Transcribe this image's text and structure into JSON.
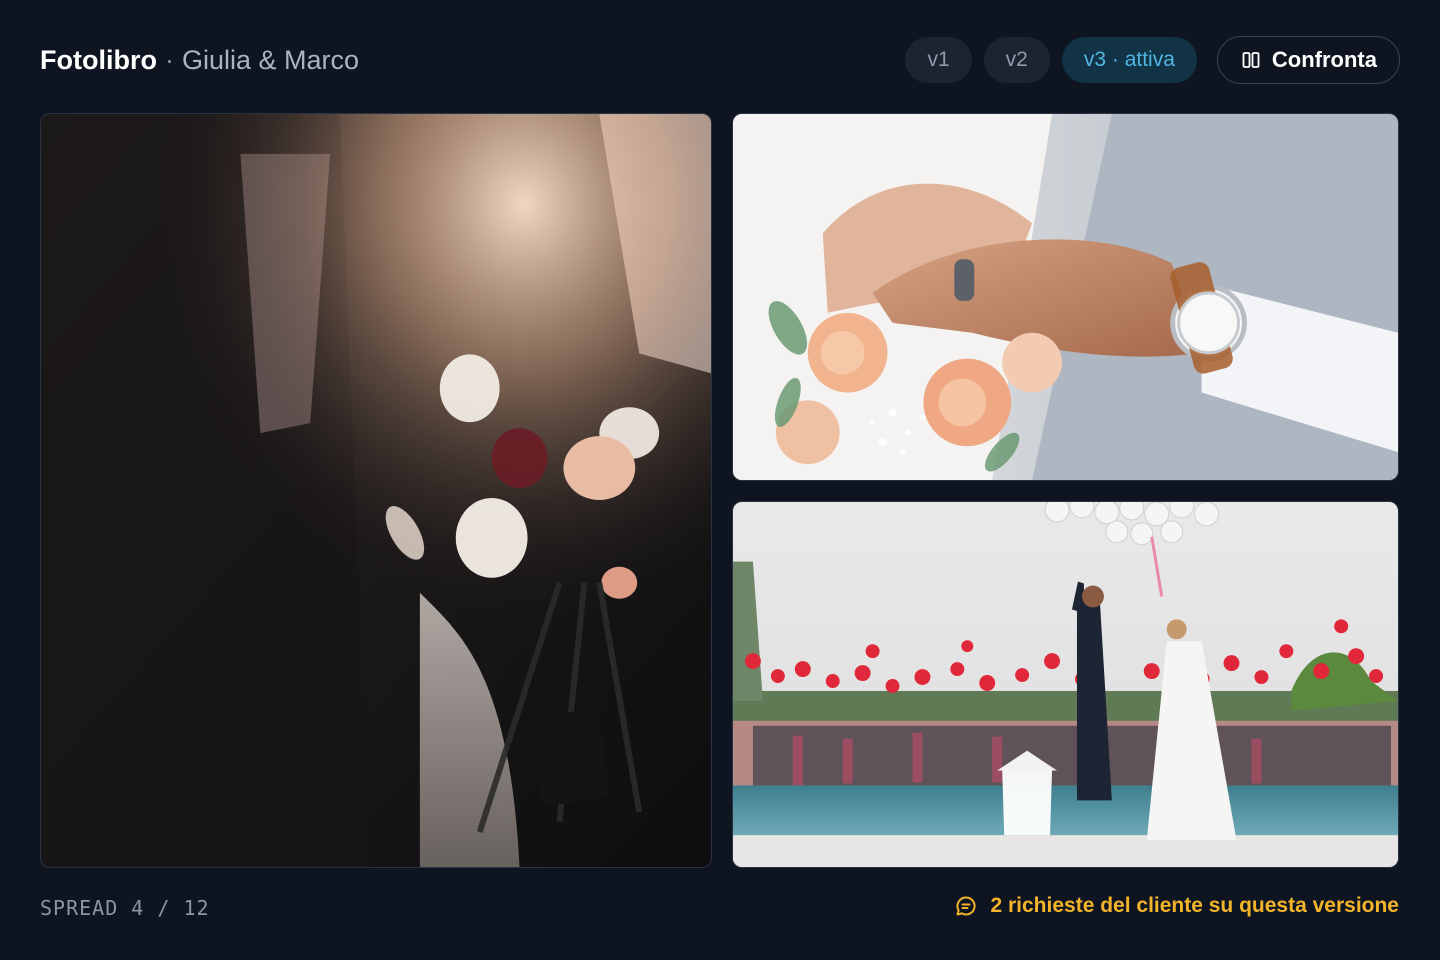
{
  "header": {
    "title": "Fotolibro",
    "separator": "·",
    "subtitle": "Giulia & Marco"
  },
  "versions": [
    {
      "label": "v1",
      "active": false
    },
    {
      "label": "v2",
      "active": false
    },
    {
      "label": "v3 · attiva",
      "active": true
    }
  ],
  "compare": {
    "label": "Confronta",
    "icon": "columns-icon"
  },
  "photos": [
    {
      "subject": "bride-bouquet-photo"
    },
    {
      "subject": "hands-rings-photo"
    },
    {
      "subject": "balloon-release-photo"
    }
  ],
  "footer": {
    "spread": "SPREAD 4 / 12",
    "requests": "2 richieste del cliente su questa versione",
    "requests_icon": "message-icon"
  },
  "colors": {
    "background": "#0f1520",
    "accent_active": "#4fb6e0",
    "warning": "#f4b42a"
  }
}
